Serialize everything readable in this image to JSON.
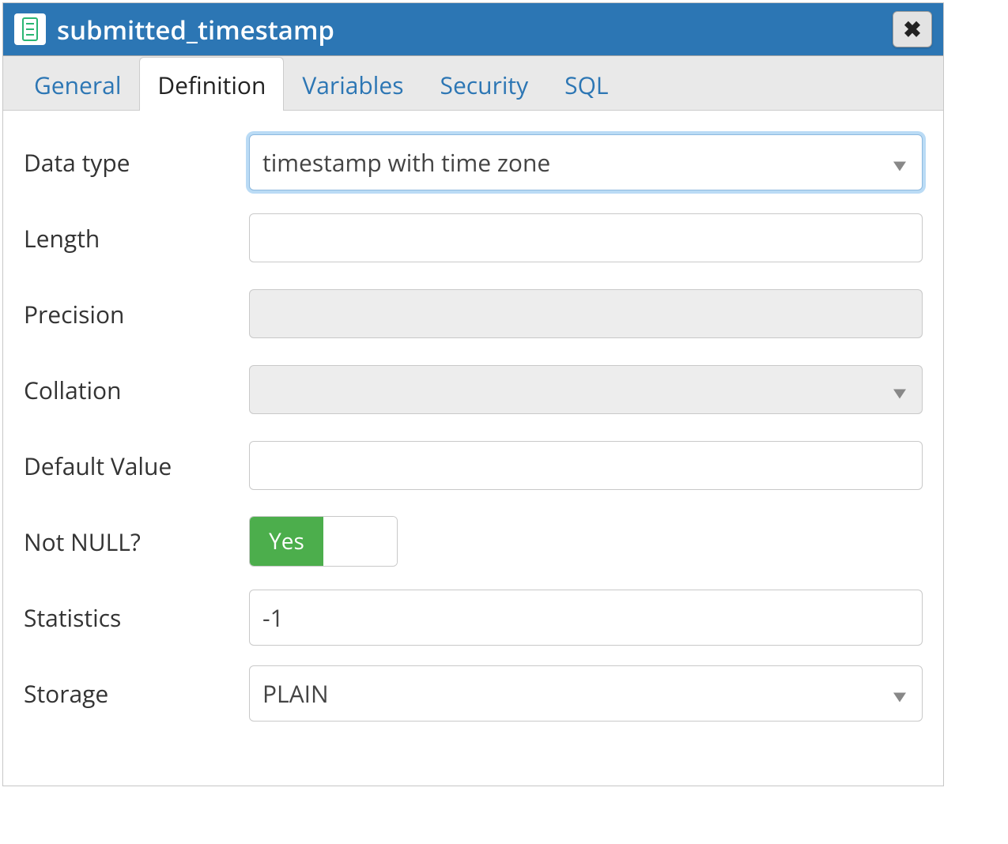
{
  "title": "submitted_timestamp",
  "tabs": {
    "general": "General",
    "definition": "Definition",
    "variables": "Variables",
    "security": "Security",
    "sql": "SQL"
  },
  "labels": {
    "data_type": "Data type",
    "length": "Length",
    "precision": "Precision",
    "collation": "Collation",
    "default_value": "Default Value",
    "not_null": "Not NULL?",
    "statistics": "Statistics",
    "storage": "Storage"
  },
  "values": {
    "data_type": "timestamp with time zone",
    "length": "",
    "precision": "",
    "collation": "",
    "default_value": "",
    "not_null_yes": "Yes",
    "statistics": "-1",
    "storage": "PLAIN"
  }
}
